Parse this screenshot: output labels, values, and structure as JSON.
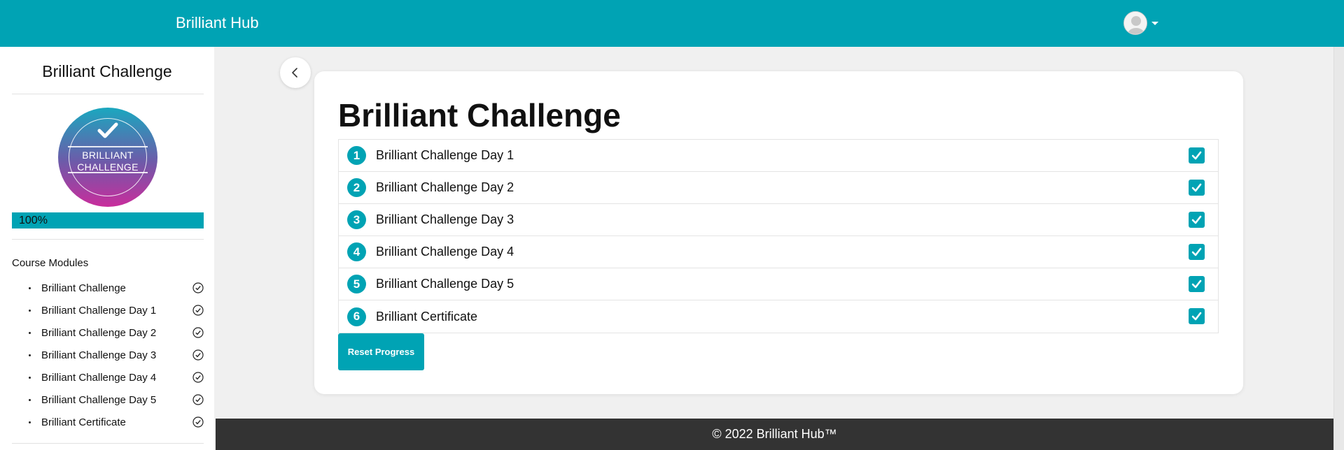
{
  "header": {
    "brand": "Brilliant Hub",
    "avatar_icon": "user-avatar-icon",
    "menu_icon": "caret-down-icon"
  },
  "sidebar": {
    "title": "Brilliant Challenge",
    "badge": {
      "line1": "BRILLIANT",
      "line2": "CHALLENGE",
      "icon": "checkmark-icon"
    },
    "progress": {
      "value": 100,
      "label": "100%"
    },
    "modules_title": "Course Modules",
    "modules": [
      {
        "label": "Brilliant Challenge",
        "status": "complete"
      },
      {
        "label": "Brilliant Challenge Day 1",
        "status": "complete"
      },
      {
        "label": "Brilliant Challenge Day 2",
        "status": "complete"
      },
      {
        "label": "Brilliant Challenge Day 3",
        "status": "complete"
      },
      {
        "label": "Brilliant Challenge Day 4",
        "status": "complete"
      },
      {
        "label": "Brilliant Challenge Day 5",
        "status": "complete"
      },
      {
        "label": "Brilliant Certificate",
        "status": "complete"
      }
    ]
  },
  "main": {
    "title": "Brilliant Challenge",
    "lessons": [
      {
        "number": "1",
        "label": "Brilliant Challenge Day 1",
        "checked": true
      },
      {
        "number": "2",
        "label": "Brilliant Challenge Day 2",
        "checked": true
      },
      {
        "number": "3",
        "label": "Brilliant Challenge Day 3",
        "checked": true
      },
      {
        "number": "4",
        "label": "Brilliant Challenge Day 4",
        "checked": true
      },
      {
        "number": "5",
        "label": "Brilliant Challenge Day 5",
        "checked": true
      },
      {
        "number": "6",
        "label": "Brilliant Certificate",
        "checked": true
      }
    ],
    "reset_label": "Reset Progress",
    "back_icon": "chevron-left-icon"
  },
  "footer": {
    "text": "© 2022 Brilliant Hub™"
  },
  "colors": {
    "accent": "#00a3b4",
    "footer": "#333333",
    "background": "#f0f0f0"
  }
}
